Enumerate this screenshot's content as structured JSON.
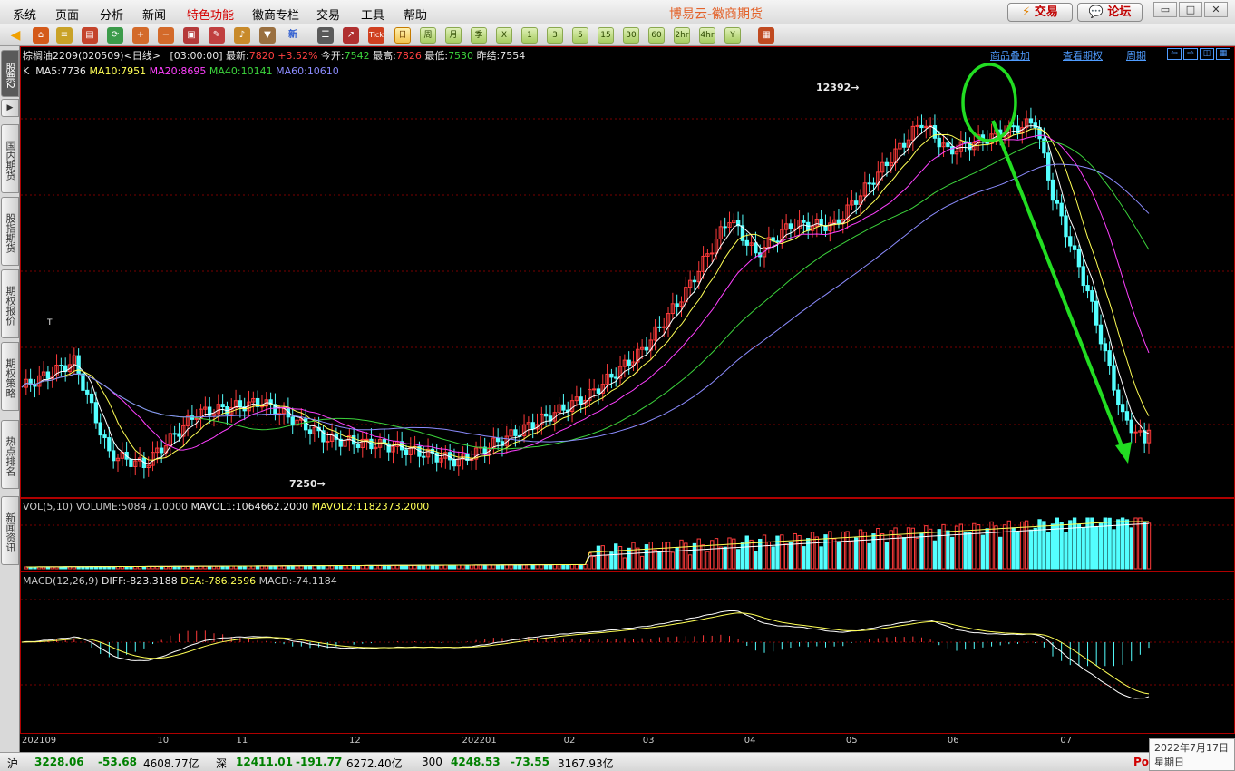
{
  "menu": {
    "items": [
      "系统",
      "页面",
      "分析",
      "新闻",
      "特色功能",
      "徽商专栏",
      "交易",
      "工具",
      "帮助"
    ],
    "title": "博易云-徽商期货",
    "trade_label": "交易",
    "forum_label": "论坛",
    "trade_icon": "lightning-icon",
    "forum_icon": "chat-bubble-icon"
  },
  "toolbar": {
    "periods": [
      "日",
      "周",
      "月",
      "季",
      "X",
      "1",
      "3",
      "5",
      "15",
      "30",
      "60",
      "2hr",
      "4hr",
      "Y"
    ],
    "selected_period": "日",
    "tick_label": "Tick",
    "news_label": "新"
  },
  "left_tabs": [
    {
      "label": "股票2",
      "active": true
    },
    {
      "label": "国内期货",
      "active": false
    },
    {
      "label": "股指期货",
      "active": false
    },
    {
      "label": "期权报价",
      "active": false
    },
    {
      "label": "期权策略",
      "active": false
    },
    {
      "label": "热点排名",
      "active": false
    },
    {
      "label": "新闻资讯",
      "active": false
    }
  ],
  "quote": {
    "instrument": "棕榈油2209",
    "code_date": "(020509)",
    "period_tag": "<日线>",
    "time": "[03:00:00]",
    "latest_label": "最新:",
    "latest": "7820",
    "change": "+3.52%",
    "open_label": "今开:",
    "open": "7542",
    "high_label": "最高:",
    "high": "7826",
    "low_label": "最低:",
    "low": "7530",
    "prev_label": "昨结:",
    "prev": "7554"
  },
  "top_links": [
    "商品叠加",
    "查看期权",
    "周期"
  ],
  "indicators": {
    "k_label": "K",
    "ma5": "MA5:7736",
    "ma10": "MA10:7951",
    "ma20": "MA20:8695",
    "ma40": "MA40:10141",
    "ma60": "MA60:10610",
    "vol_label": "VOL(5,10)",
    "volume": "VOLUME:508471.0000",
    "mavol1": "MAVOL1:1064662.2000",
    "mavol2": "MAVOL2:1182373.2000",
    "macd_label": "MACD(12,26,9)",
    "diff": "DIFF:-823.3188",
    "dea": "DEA:-786.2596",
    "macd": "MACD:-74.1184"
  },
  "annotations": {
    "high_mark": "12392→",
    "low_mark": "7250→",
    "tick_t": "T"
  },
  "colors": {
    "up": "#ff3b3b",
    "down": "#54ffff",
    "ma5": "#ffffff",
    "ma10": "#ffff55",
    "ma20": "#ff40ff",
    "ma40": "#3cd43c",
    "ma60": "#8c8cff",
    "annotation": "#22dd22"
  },
  "chart_data": {
    "type": "candlestick",
    "title": "棕榈油2209 日线",
    "xlabel": "",
    "ylabel": "",
    "x_labels": [
      "202109",
      "10",
      "11",
      "12",
      "202201",
      "02",
      "03",
      "04",
      "05",
      "06",
      "07"
    ],
    "ylim": [
      7000,
      12800
    ],
    "marked_high": 12392,
    "marked_low": 7250,
    "latest_close": 7820,
    "ma_last": {
      "MA5": 7736,
      "MA10": 7951,
      "MA20": 8695,
      "MA40": 10141,
      "MA60": 10610
    },
    "macd_last": {
      "DIFF": -823.3188,
      "DEA": -786.2596,
      "MACD": -74.1184
    },
    "grid": true
  },
  "status": {
    "sh_label": "沪",
    "sh_index": "3228.06",
    "sh_change": "-53.68",
    "sh_amount": "4608.77亿",
    "sz_label": "深",
    "sz_index": "12411.01",
    "sz_change": "-191.77",
    "sz_amount": "6272.40亿",
    "c300_label": "300",
    "c300_index": "4248.53",
    "c300_change": "-73.55",
    "c300_amount": "3167.93亿",
    "date": "2022年7月17日",
    "weekday": "星期日",
    "po": "Po"
  }
}
